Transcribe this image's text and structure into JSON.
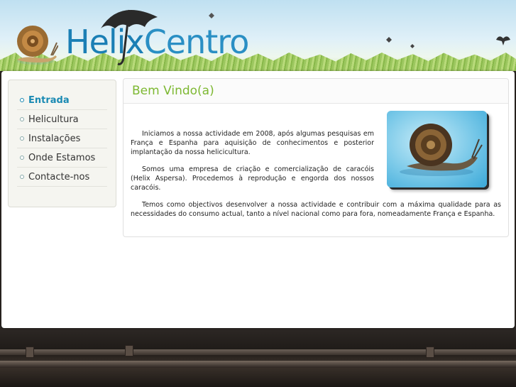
{
  "header": {
    "logo_part1": "Helix",
    "logo_part2": "Centro"
  },
  "sidebar": {
    "items": [
      {
        "label": "Entrada",
        "active": true
      },
      {
        "label": "Helicultura",
        "active": false
      },
      {
        "label": "Instalações",
        "active": false
      },
      {
        "label": "Onde Estamos",
        "active": false
      },
      {
        "label": "Contacte-nos",
        "active": false
      }
    ]
  },
  "content": {
    "title": "Bem Vindo(a)",
    "paragraphs": [
      "Iniciamos a nossa actividade em 2008, após algumas pesquisas em França e Espanha para aquisição de conhecimentos e posterior implantação da nossa helicicultura.",
      "Somos uma empresa de criação e comercialização de caracóis (Helix Aspersa). Procedemos à reprodução e engorda dos nossos caracóis.",
      "Temos como objectivos desenvolver a nossa actividade e contribuir com a máxima qualidade para as necessidades do consumo actual, tanto a nível nacional como para fora, nomeadamente França e Espanha."
    ]
  },
  "colors": {
    "logo": "#1b7fb5",
    "title": "#7db832",
    "nav_active": "#1a8ab3"
  },
  "icons": [
    "snail-logo-icon",
    "umbrella-icon",
    "bird-icon",
    "snail-photo"
  ]
}
